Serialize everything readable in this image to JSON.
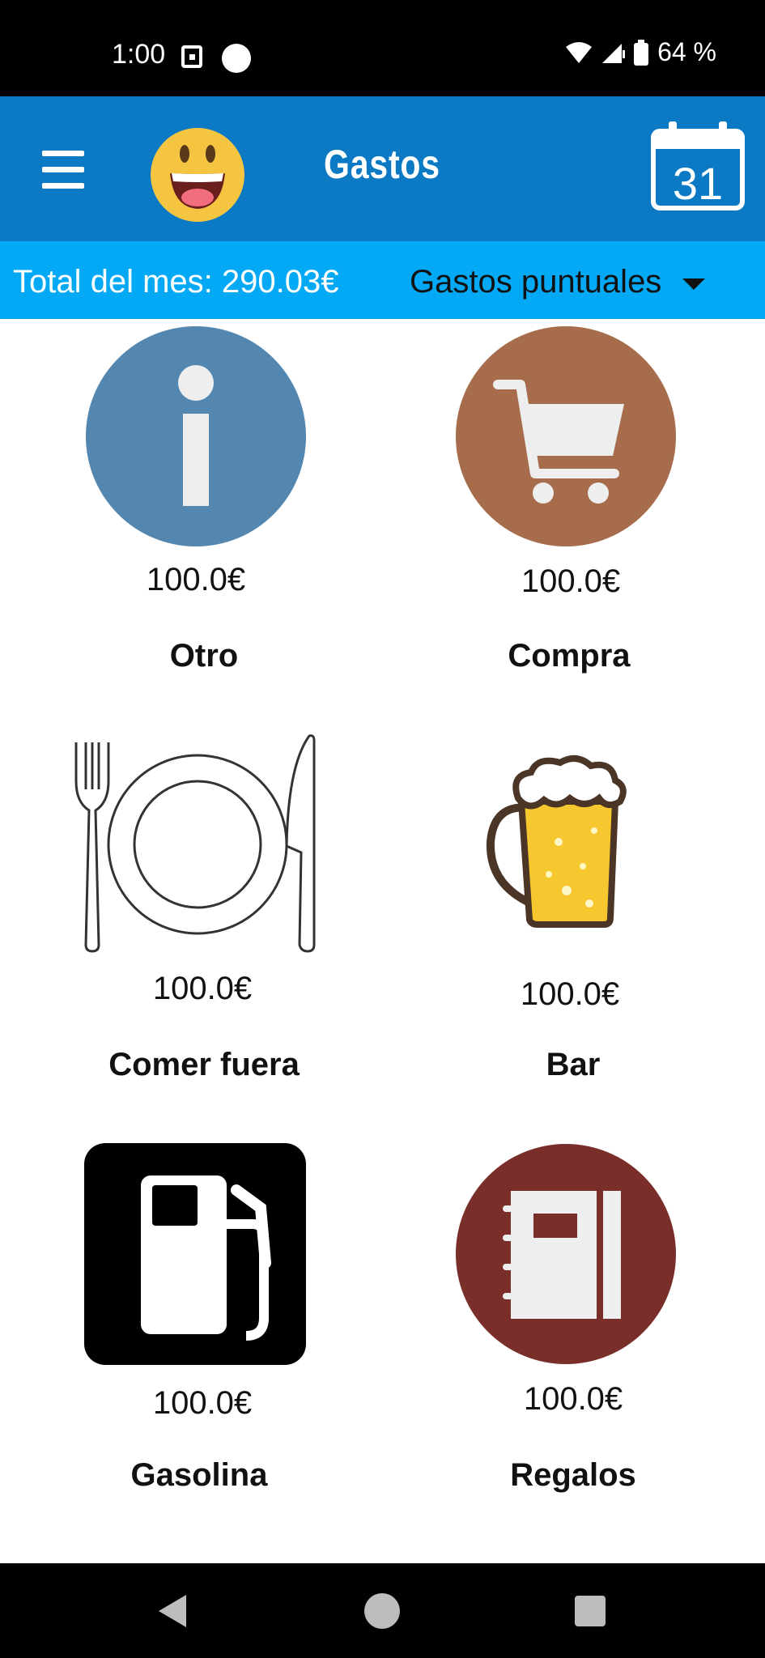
{
  "status_bar": {
    "time": "1:00",
    "battery": "64 %"
  },
  "app_bar": {
    "title": "Gastos"
  },
  "calendar": {
    "day": "31"
  },
  "summary": {
    "total": "Total del mes: 290.03€",
    "filter": "Gastos puntuales"
  },
  "categories": [
    {
      "name": "Otro",
      "amount": "100.0€",
      "icon": "info-icon"
    },
    {
      "name": "Compra",
      "amount": "100.0€",
      "icon": "shopping-cart-icon"
    },
    {
      "name": "Comer fuera",
      "amount": "100.0€",
      "icon": "plate-cutlery-icon"
    },
    {
      "name": "Bar",
      "amount": "100.0€",
      "icon": "beer-mug-icon"
    },
    {
      "name": "Gasolina",
      "amount": "100.0€",
      "icon": "fuel-pump-icon"
    },
    {
      "name": "Regalos",
      "amount": "100.0€",
      "icon": "notebook-icon"
    }
  ],
  "colors": {
    "app_bar": "#0b79c4",
    "sub_bar": "#03a9f4",
    "info": "#5487b0",
    "cart": "#a66c4b",
    "gift": "#7a2e2a",
    "beer": "#f6c72e"
  }
}
